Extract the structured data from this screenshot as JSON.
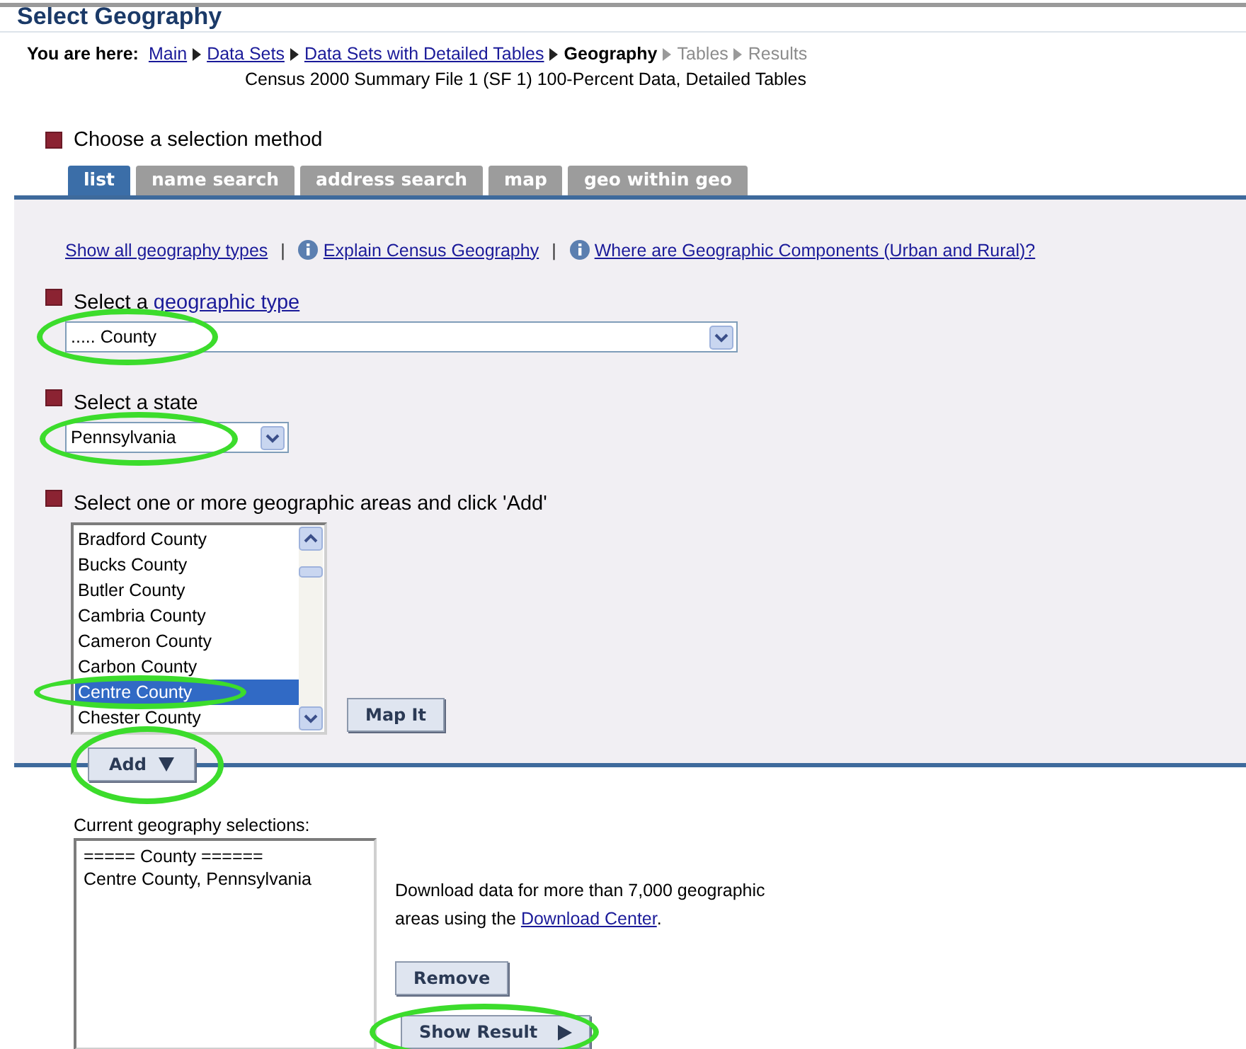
{
  "title": "Select Geography",
  "breadcrumb": {
    "label": "You are here:",
    "items": [
      {
        "text": "Main",
        "kind": "link"
      },
      {
        "text": "Data Sets",
        "kind": "link"
      },
      {
        "text": "Data Sets with Detailed Tables",
        "kind": "link"
      },
      {
        "text": "Geography",
        "kind": "current"
      },
      {
        "text": "Tables",
        "kind": "future"
      },
      {
        "text": "Results",
        "kind": "future"
      }
    ]
  },
  "dataset": "Census 2000 Summary File 1 (SF 1) 100-Percent Data, Detailed Tables",
  "method_heading": "Choose a selection method",
  "tabs": [
    {
      "label": "list",
      "selected": true
    },
    {
      "label": "name search",
      "selected": false
    },
    {
      "label": "address search",
      "selected": false
    },
    {
      "label": "map",
      "selected": false
    },
    {
      "label": "geo within geo",
      "selected": false
    }
  ],
  "links": [
    {
      "text": "Show all geography types",
      "info": false
    },
    {
      "separator": "|",
      "text": "Explain Census Geography",
      "info": true
    },
    {
      "separator": "|",
      "text": "Where are Geographic Components (Urban and Rural)?",
      "info": true
    }
  ],
  "geo_type": {
    "label": "Select a ",
    "label_link": "geographic type",
    "value": "..... County",
    "highlighted": true
  },
  "state": {
    "label": "Select a state",
    "value": "Pennsylvania",
    "highlighted": true
  },
  "areas": {
    "label": "Select one or more geographic areas and click 'Add'",
    "items": [
      {
        "text": "Bradford County",
        "selected": false,
        "highlighted": false
      },
      {
        "text": "Bucks County",
        "selected": false,
        "highlighted": false
      },
      {
        "text": "Butler County",
        "selected": false,
        "highlighted": false
      },
      {
        "text": "Cambria County",
        "selected": false,
        "highlighted": false
      },
      {
        "text": "Cameron County",
        "selected": false,
        "highlighted": false
      },
      {
        "text": "Carbon County",
        "selected": false,
        "highlighted": false
      },
      {
        "text": "Centre County",
        "selected": true,
        "highlighted": true
      },
      {
        "text": "Chester County",
        "selected": false,
        "highlighted": false
      }
    ],
    "map_button": "Map It"
  },
  "add_button": {
    "label": "Add",
    "highlighted": true
  },
  "selections": {
    "label": "Current geography selections:",
    "items": [
      "===== County ======",
      "Centre County, Pennsylvania"
    ]
  },
  "download": {
    "text": "Download data for more than 7,000 geographic areas using the ",
    "link": "Download Center",
    "after": "."
  },
  "remove_button": {
    "label": "Remove"
  },
  "show_result_button": {
    "label": "Show Result",
    "highlighted": true
  }
}
